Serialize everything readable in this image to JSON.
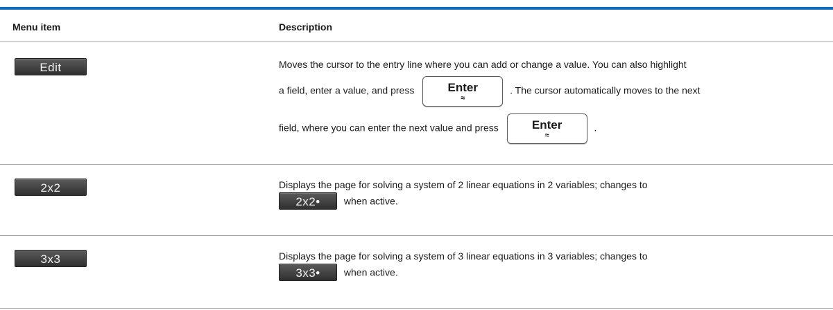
{
  "table": {
    "headers": {
      "menu_item": "Menu item",
      "description": "Description"
    },
    "rows": [
      {
        "key_label": "Edit",
        "desc": {
          "line1": "Moves the cursor to the entry line where you can add or change a value. You can also highlight",
          "line2_pre": "a field, enter a value, and press",
          "line2_post": ". The cursor automatically moves to the next",
          "line3_pre": "field, where you can enter the next value and press",
          "line3_post": "."
        }
      },
      {
        "key_label": "2x2",
        "desc": {
          "line1": "Displays the page for solving a system of 2 linear equations in 2 variables; changes to",
          "active_key_label": "2x2•",
          "line2_post": "when active."
        }
      },
      {
        "key_label": "3x3",
        "desc": {
          "line1": "Displays the page for solving a system of 3 linear equations in 3 variables; changes to",
          "active_key_label": "3x3•",
          "line2_post": "when active."
        }
      }
    ]
  },
  "enter_key": {
    "label": "Enter",
    "secondary": "≈"
  },
  "colors": {
    "accent_rule": "#0a6fc2",
    "softkey_bg": "#3c3c3c",
    "divider": "#9aa3ab"
  }
}
